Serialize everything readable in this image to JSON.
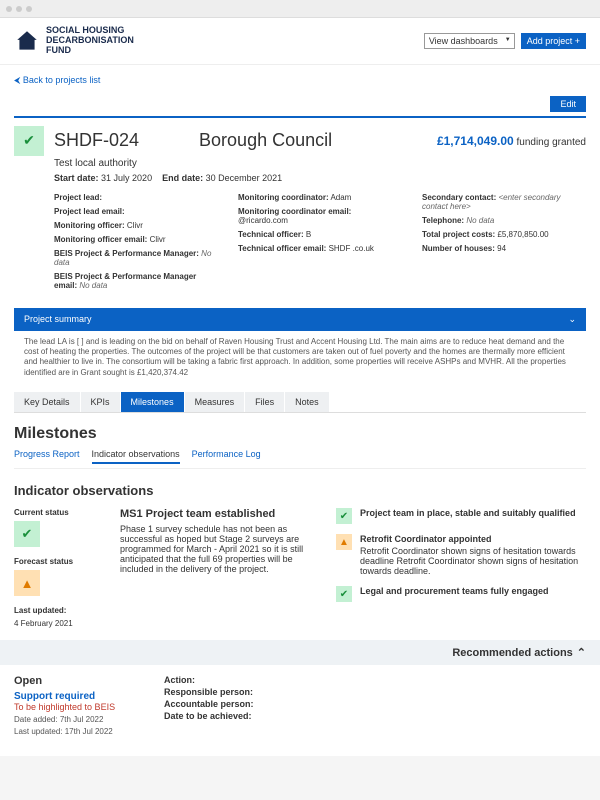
{
  "logo": {
    "line1": "SOCIAL HOUSING",
    "line2": "DECARBONISATION",
    "line3": "FUND"
  },
  "header": {
    "viewDashboards": "View dashboards",
    "addProject": "Add project +"
  },
  "backLink": "⮜ Back to projects list",
  "editBtn": "Edit",
  "project": {
    "code": "SHDF-024",
    "council": "Borough Council",
    "fundingAmount": "£1,714,049.00",
    "fundingLabel": "funding granted",
    "subtitle": "Test local authority",
    "startDateLabel": "Start date:",
    "startDate": "31 July 2020",
    "endDateLabel": "End date:",
    "endDate": "30 December 2021"
  },
  "details": {
    "col1": {
      "projectLeadLabel": "Project lead:",
      "projectLead": "",
      "projectLeadEmailLabel": "Project lead email:",
      "projectLeadEmail": "",
      "monOfficerLabel": "Monitoring officer:",
      "monOfficer": "Clivr",
      "monOfficerEmailLabel": "Monitoring officer email:",
      "monOfficerEmail": "Clivr",
      "beisMgrLabel": "BEIS Project & Performance Manager:",
      "beisMgr": "No data",
      "beisMgrEmailLabel": "BEIS Project & Performance Manager email:",
      "beisMgrEmail": "No data"
    },
    "col2": {
      "monCoordLabel": "Monitoring coordinator:",
      "monCoord": "Adam",
      "monCoordEmailLabel": "Monitoring coordinator email:",
      "monCoordEmail": "@ricardo.com",
      "techOfficerLabel": "Technical officer:",
      "techOfficer": "B",
      "techOfficerEmailLabel": "Technical officer email:",
      "techOfficerEmail": "SHDF        .co.uk"
    },
    "col3": {
      "secContactLabel": "Secondary contact:",
      "secContact": "<enter secondary contact here>",
      "telLabel": "Telephone:",
      "tel": "No data",
      "totalCostLabel": "Total project costs:",
      "totalCost": "£5,870,850.00",
      "housesLabel": "Number of houses:",
      "houses": "94"
    }
  },
  "summaryBar": "Project summary",
  "summaryText": "The lead LA is [   ] and is leading on the bid on behalf of Raven Housing Trust and Accent Housing Ltd. The main aims are to reduce heat demand and the cost of heating the properties. The outcomes of the project will be that customers are taken out of fuel poverty and the homes are thermally more efficient and healthier to live in. The consortium will be taking a fabric first approach. In addition, some properties will receive ASHPs and MVHR. All the properties identified are in        Grant sought is £1,420,374.42",
  "tabs": {
    "keyDetails": "Key Details",
    "kpis": "KPIs",
    "milestones": "Milestones",
    "measures": "Measures",
    "files": "Files",
    "notes": "Notes"
  },
  "sectionTitle": "Milestones",
  "subtabs": {
    "progress": "Progress Report",
    "indicator": "Indicator observations",
    "perflog": "Performance Log"
  },
  "subsectionTitle": "Indicator observations",
  "obs": {
    "currentStatusLabel": "Current status",
    "forecastStatusLabel": "Forecast status",
    "lastUpdatedLabel": "Last updated:",
    "lastUpdated": "4 February 2021",
    "msTitle": "MS1 Project team established",
    "msBody": "Phase 1 survey schedule has not been as successful as hoped but Stage 2 surveys are programmed for March - April 2021 so it is still anticipated that the full 69 properties will be included in the delivery of the project.",
    "items": [
      {
        "status": "ok",
        "title": "Project team in place, stable and suitably qualified",
        "body": ""
      },
      {
        "status": "warn",
        "title": "Retrofit Coordinator appointed",
        "body": "Retrofit Coordinator shown signs of hesitation towards deadline Retrofit Coordinator shown signs of hesitation towards deadline."
      },
      {
        "status": "ok",
        "title": "Legal and procurement teams fully engaged",
        "body": ""
      }
    ]
  },
  "recommended": "Recommended actions",
  "actions": {
    "open": "Open",
    "support": "Support required",
    "beis": "To be highlighted to BEIS",
    "dateAddedLabel": "Date added:",
    "dateAdded": "7th Jul 2022",
    "lastUpdatedLabel": "Last updated:",
    "lastUpdated": "17th Jul 2022",
    "actionLabel": "Action:",
    "respLabel": "Responsible person:",
    "acctLabel": "Accountable person:",
    "dateAchLabel": "Date to be achieved:"
  }
}
